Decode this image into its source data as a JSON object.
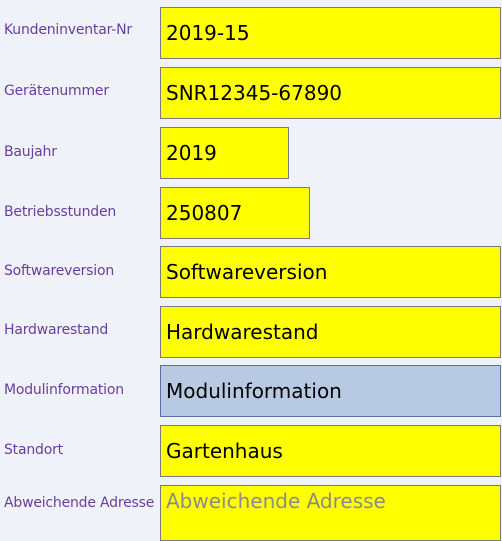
{
  "form": {
    "fields": [
      {
        "key": "kundeninventar",
        "label": "Kundeninventar-Nr",
        "value": "2019-15",
        "placeholder": ""
      },
      {
        "key": "geraetenummer",
        "label": "Gerätenummer",
        "value": "SNR12345-67890",
        "placeholder": ""
      },
      {
        "key": "baujahr",
        "label": "Baujahr",
        "value": "2019",
        "placeholder": ""
      },
      {
        "key": "betriebsstunden",
        "label": "Betriebsstunden",
        "value": "250807",
        "placeholder": ""
      },
      {
        "key": "softwareversion",
        "label": "Softwareversion",
        "value": "Softwareversion",
        "placeholder": ""
      },
      {
        "key": "hardwarestand",
        "label": "Hardwarestand",
        "value": "Hardwarestand",
        "placeholder": ""
      },
      {
        "key": "modulinformation",
        "label": "Modulinformation",
        "value": "Modulinformation",
        "placeholder": ""
      },
      {
        "key": "standort",
        "label": "Standort",
        "value": "Gartenhaus",
        "placeholder": ""
      },
      {
        "key": "abweichende_adresse",
        "label": "Abweichende Adresse",
        "value": "",
        "placeholder": "Abweichende Adresse"
      }
    ]
  },
  "colors": {
    "background": "#eff2f8",
    "label": "#6a3ea0",
    "field_background": "#ffff00",
    "field_highlight": "#b8c9e4",
    "field_border": "#7a7a7a"
  }
}
